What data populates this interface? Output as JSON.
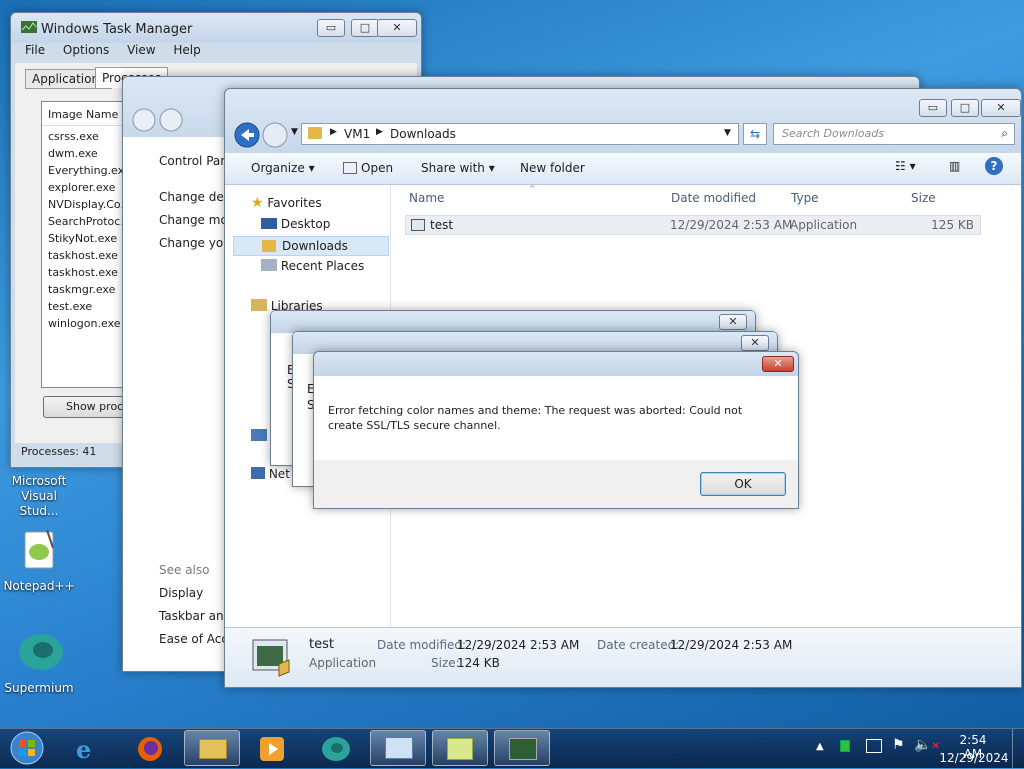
{
  "taskmgr": {
    "title": "Windows Task Manager",
    "menu": [
      "File",
      "Options",
      "View",
      "Help"
    ],
    "tabs": [
      "Applications",
      "Processes"
    ],
    "column": "Image Name",
    "processes": [
      "csrss.exe",
      "dwm.exe",
      "Everything.exe",
      "explorer.exe",
      "NVDisplay.Co...",
      "SearchProtoc...",
      "StikyNot.exe",
      "taskhost.exe",
      "taskhost.exe",
      "taskmgr.exe",
      "test.exe",
      "winlogon.exe"
    ],
    "show_button": "Show proce",
    "status": "Processes: 41"
  },
  "control_panel": {
    "items": [
      "Control Pane",
      "Change desk",
      "Change mou",
      "Change you"
    ],
    "see_also": "See also",
    "links": [
      "Display",
      "Taskbar and",
      "Ease of Acce"
    ]
  },
  "explorer": {
    "breadcrumb": [
      "VM1",
      "Downloads"
    ],
    "search_placeholder": "Search Downloads",
    "toolbar": {
      "organize": "Organize",
      "open": "Open",
      "share": "Share with",
      "new_folder": "New folder"
    },
    "nav": {
      "favorites": "Favorites",
      "items": [
        "Desktop",
        "Downloads",
        "Recent Places"
      ],
      "libraries": "Libraries",
      "network": "Net"
    },
    "columns": {
      "name": "Name",
      "date": "Date modified",
      "type": "Type",
      "size": "Size"
    },
    "file": {
      "name": "test",
      "date": "12/29/2024 2:53 AM",
      "type": "Application",
      "size": "125 KB"
    },
    "details": {
      "name": "test",
      "type": "Application",
      "date_modified_label": "Date modified:",
      "date_modified": "12/29/2024 2:53 AM",
      "size_label": "Size:",
      "size": "124 KB",
      "date_created_label": "Date created:",
      "date_created": "12/29/2024 2:53 AM"
    }
  },
  "dialog": {
    "message": "Error fetching color names and theme: The request was aborted: Could not create SSL/TLS secure channel.",
    "ok": "OK",
    "behind_letters": [
      "E",
      "S"
    ]
  },
  "desktop_icons": [
    {
      "label": "Microsoft Visual Stud..."
    },
    {
      "label": "Notepad++"
    },
    {
      "label": "Supermium"
    }
  ],
  "clock": {
    "time": "2:54 AM",
    "date": "12/29/2024"
  }
}
